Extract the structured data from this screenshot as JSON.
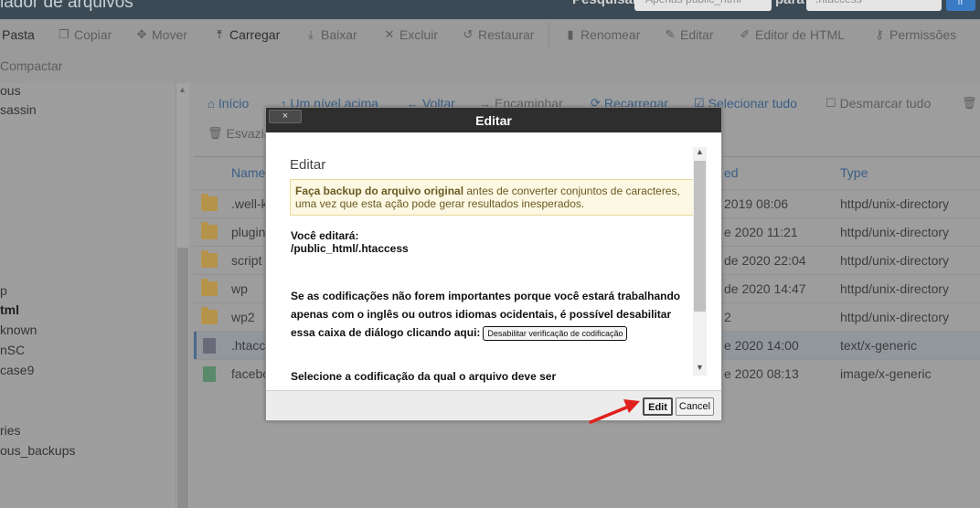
{
  "header": {
    "title": "iador de arquivos",
    "search_label": "Pesquisar",
    "search_scope": "Apenas public_html",
    "para_label": "para",
    "search_value": ".htaccess",
    "go_label": "ir"
  },
  "toolbar": {
    "pasta": "Pasta",
    "copiar": "Copiar",
    "mover": "Mover",
    "carregar": "Carregar",
    "baixar": "Baixar",
    "excluir": "Excluir",
    "restaurar": "Restaurar",
    "renomear": "Renomear",
    "editar": "Editar",
    "editor_html": "Editor de HTML",
    "permissoes": "Permissões",
    "compactar": "Compactar"
  },
  "sidebar": {
    "items": [
      "ous",
      "sassin",
      "p",
      "tml",
      "known",
      "nSC",
      "case9",
      "ries",
      "ous_backups"
    ]
  },
  "nav": {
    "inicio": "Início",
    "nivel_acima": "Um nível acima",
    "voltar": "Voltar",
    "encaminhar": "Encaminhar",
    "recarregar": "Recarregar",
    "selecionar_tudo": "Selecionar tudo",
    "desmarcar_tudo": "Desmarcar tudo",
    "esvaziar": "Esvazia"
  },
  "table": {
    "col_name": "Name",
    "col_modified": "ed",
    "col_type": "Type",
    "rows": [
      {
        "name": ".well-k",
        "date": "2019 08:06",
        "type": "httpd/unix-directory"
      },
      {
        "name": "plugin",
        "date": "e 2020 11:21",
        "type": "httpd/unix-directory"
      },
      {
        "name": "script",
        "date": "de 2020 22:04",
        "type": "httpd/unix-directory"
      },
      {
        "name": "wp",
        "date": "de 2020 14:47",
        "type": "httpd/unix-directory"
      },
      {
        "name": "wp2",
        "date": "2",
        "type": "httpd/unix-directory"
      },
      {
        "name": ".htacc",
        "date": "e 2020 14:00",
        "type": "text/x-generic"
      },
      {
        "name": "facebo",
        "date": "e 2020 08:13",
        "type": "image/x-generic"
      }
    ]
  },
  "modal": {
    "title": "Editar",
    "close_label": "×",
    "heading": "Editar",
    "warn_bold": "Faça backup do arquivo original",
    "warn_rest": " antes de converter conjuntos de caracteres, uma vez que esta ação pode gerar resultados inesperados.",
    "voce_editara": "Você editará:",
    "path": "/public_html/.htaccess",
    "info": "Se as codificações não forem importantes porque você estará trabalhando apenas com o inglês ou outros idiomas ocidentais, é possível desabilitar essa caixa de diálogo clicando aqui:",
    "disable_btn": "Desabilitar verificação de codificação",
    "cut_text": "Selecione a codificação da qual o arquivo deve ser",
    "edit_btn": "Edit",
    "cancel_btn": "Cancel"
  },
  "colors": {
    "accent_link": "#3a5e86",
    "modal_header": "#2e2e2e",
    "warning_bg": "#fcf8e3",
    "arrow": "#e0201c"
  }
}
